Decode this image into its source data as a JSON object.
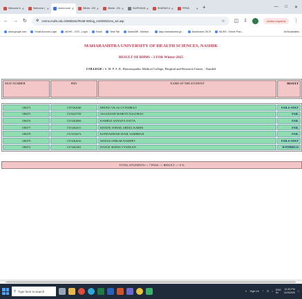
{
  "browser": {
    "tabs": [
      {
        "label": "Welcome to",
        "active": false
      },
      {
        "label": "Welcome | li",
        "active": false
      },
      {
        "label": "cermo.muhs.",
        "active": true
      },
      {
        "label": "Winter -2025",
        "active": false
      },
      {
        "label": "Winter -2025",
        "active": false
      },
      {
        "label": "SIAPKHANC",
        "active": false
      },
      {
        "label": "SHARAR AN",
        "active": false
      },
      {
        "label": "PRNS",
        "active": false
      }
    ],
    "new_tab": "+",
    "url": "cermo.muhs.edu.in/MSitetor/RUM-W3/ug_res/W25/cres_w4.asp",
    "action_required": "Action required",
    "bookmarks": [
      "www.google.com",
      "Email Account Login",
      "MUHS - OTD - Login",
      "Email",
      "New Tab",
      "Mahar38f - Mahara...",
      "sarju.maharashtra.go...",
      "Dashboard | NCH",
      "MUHS - Online Prac..."
    ],
    "all_bookmarks": "All Bookmarks"
  },
  "report": {
    "university": "MAHARASHTRA UNIVERSITY OF HEALTH SCIENCES, NASHIK",
    "result_title": "RESULT OF BHMS - 3 FOR Winter-2025",
    "college_label": "COLLEGE :",
    "college_name": "S. M. P. S. K. Homoeopathic Medical College, Hospital and Research Centre, , Nanded",
    "columns": [
      "SEAT NUMBER",
      "PRN",
      "NAME OF THE STUDENT",
      "RESULT"
    ],
    "rows": [
      {
        "seat": "180473",
        "prn": "1507262048",
        "name": "BHONG VILAS UTTAMRAO",
        "result": "FAILS-ATKT"
      },
      {
        "seat": "180475",
        "prn": "1510223758",
        "name": "JAGADAND MAROTI NAGORAO",
        "result": "FAIL"
      },
      {
        "seat": "180476",
        "prn": "1515262806",
        "name": "KAMBLE SANGITA DATTA",
        "result": "FAIL"
      },
      {
        "seat": "180477",
        "prn": "1515262611",
        "name": "KHATIK SOHAIL ABDUL KARIM",
        "result": "FAIL"
      },
      {
        "seat": "180478",
        "prn": "1515232672",
        "name": "KONDAMWAR SUNIL SAMBHAJI",
        "result": "FAIL"
      },
      {
        "seat": "180479",
        "prn": "1515262616",
        "name": "MADAS OMKAR NAMDEV",
        "result": "FAILS-ATKT"
      },
      {
        "seat": "180474",
        "prn": "1515262381",
        "name": "DANGE SEEMA VYANKATI",
        "result": "WITHHELD"
      }
    ],
    "total_line": "TOTAL STUDENTS:-> 7      PASS :->      RESULT :-> 0 %"
  },
  "taskbar": {
    "search_placeholder": "Type here to search",
    "weather": "High UV",
    "language": "ENG\nIN",
    "time": "12:45 PM",
    "date": "3/19/2026"
  },
  "colors": {
    "header_red": "#d0304a",
    "row_green": "#8fddb0",
    "header_pink": "#f3c7c7",
    "result_blue": "#1a2a6a"
  }
}
